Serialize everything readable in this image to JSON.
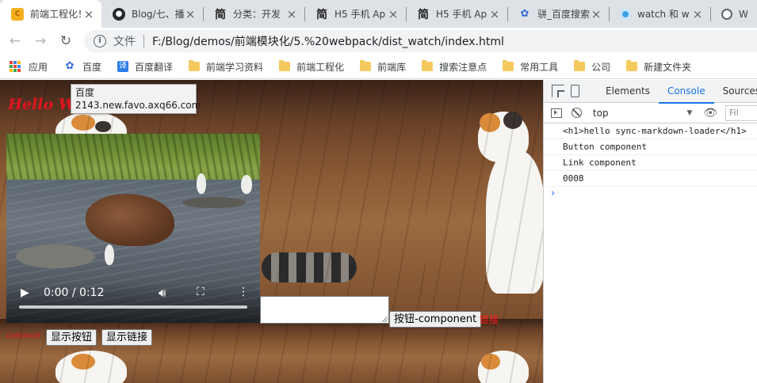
{
  "tabs": [
    {
      "title": "前端工程化！",
      "favicon": "cc-icon",
      "active": true
    },
    {
      "title": "Blog/七、播",
      "favicon": "github-icon",
      "active": false
    },
    {
      "title": "分类：开发",
      "favicon": "jianshu-icon",
      "active": false
    },
    {
      "title": "H5 手机 Ap",
      "favicon": "jianshu-icon",
      "active": false
    },
    {
      "title": "H5 手机 Ap",
      "favicon": "jianshu-icon",
      "active": false
    },
    {
      "title": "骈_百度搜索",
      "favicon": "baidu-icon",
      "active": false
    },
    {
      "title": "watch 和 w",
      "favicon": "watch-icon",
      "active": false
    },
    {
      "title": "We",
      "favicon": "globe-icon",
      "active": false
    }
  ],
  "toolbar": {
    "back_icon": "←",
    "forward_icon": "→",
    "reload_icon": "↻",
    "info_glyph": "i",
    "scheme_label": "文件",
    "url": "F:/Blog/demos/前端模块化/5.%20webpack/dist_watch/index.html"
  },
  "bookmarks": [
    {
      "label": "应用",
      "icon": "apps-icon"
    },
    {
      "label": "百度",
      "icon": "baidu-paw-icon"
    },
    {
      "label": "百度翻译",
      "icon": "fanyi-icon"
    },
    {
      "label": "前端学习资料",
      "icon": "folder-icon"
    },
    {
      "label": "前端工程化",
      "icon": "folder-icon"
    },
    {
      "label": "前端库",
      "icon": "folder-icon"
    },
    {
      "label": "搜索注意点",
      "icon": "folder-icon"
    },
    {
      "label": "常用工具",
      "icon": "folder-icon"
    },
    {
      "label": "公司",
      "icon": "folder-icon"
    },
    {
      "label": "新建文件夹",
      "icon": "folder-icon"
    }
  ],
  "page": {
    "hello_heading": "Hello W",
    "tooltip": {
      "line1": "百度",
      "line2": "2143.new.favo.axq66.com"
    },
    "video": {
      "time": "0:00 / 0:12"
    },
    "button_component": "按钮-component",
    "link_text": "链接",
    "common_text": "common",
    "show_button": "显示按钮",
    "show_link": "显示链接"
  },
  "devtools": {
    "tabs": [
      "Elements",
      "Console",
      "Sources"
    ],
    "active_tab": "Console",
    "context": "top",
    "filter_placeholder": "Fil",
    "logs": [
      "<h1>hello sync-markdown-loader</h1>",
      "Button component",
      "Link component",
      "0008"
    ],
    "prompt": "›"
  },
  "colors": {
    "accent": "#1a73e8",
    "heading_red": "#e0141e",
    "link_red": "#ff1a1a",
    "tabbar_bg": "#dee1e6"
  }
}
